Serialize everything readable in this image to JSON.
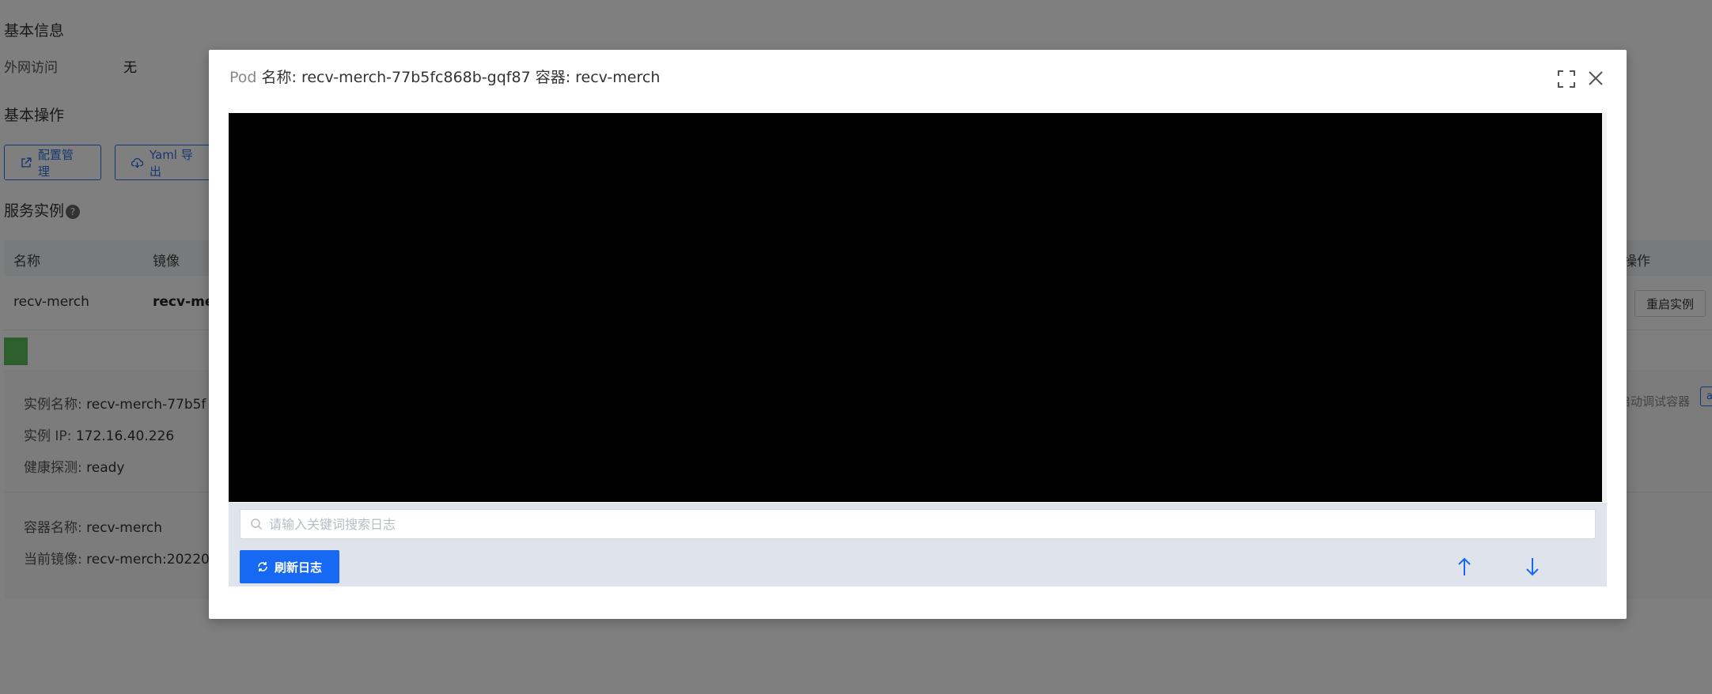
{
  "page": {
    "basic_info_title": "基本信息",
    "external_access_label": "外网访问",
    "external_access_value": "无",
    "basic_ops_title": "基本操作",
    "buttons": {
      "config_manage": "配置管理",
      "yaml_export": "Yaml 导出"
    },
    "service_instances_title": "服务实例",
    "table": {
      "headers": {
        "name": "名称",
        "image": "镜像",
        "actions": "操作"
      },
      "row": {
        "name": "recv-merch",
        "image": "recv-merc",
        "restart_label": "重启实例"
      }
    },
    "instance_detail": {
      "name_label": "实例名称:",
      "name_value": "recv-merch-77b5f",
      "ip_label": "实例 IP:",
      "ip_value": "172.16.40.226",
      "health_label": "健康探测:",
      "health_value": "ready",
      "container_label": "容器名称:",
      "container_value": "recv-merch",
      "image_label": "当前镜像:",
      "image_value": "recv-merch:20220",
      "debug_container_label": "启动调试容器",
      "edge_tag": "a"
    }
  },
  "modal": {
    "pod_prefix": "Pod",
    "pod_name_label": "名称:",
    "pod_name": "recv-merch-77b5fc868b-gqf87",
    "container_label": "容器:",
    "container_name": "recv-merch",
    "search_placeholder": "请输入关键词搜索日志",
    "refresh_label": "刷新日志"
  },
  "colors": {
    "primary": "#1769f4",
    "log_background": "#000000",
    "toolbar_background": "#dfe4ec",
    "overlay": "rgba(0,0,0,0.5)",
    "status_green": "#5cc15c"
  },
  "icons": {
    "fullscreen": "fullscreen-icon",
    "close": "close-icon",
    "search": "search-icon",
    "refresh": "refresh-icon",
    "scroll_top": "arrow-up-icon",
    "scroll_bottom": "arrow-down-icon",
    "external_link": "external-link-icon",
    "cloud_download": "cloud-download-icon",
    "help": "help-icon"
  }
}
